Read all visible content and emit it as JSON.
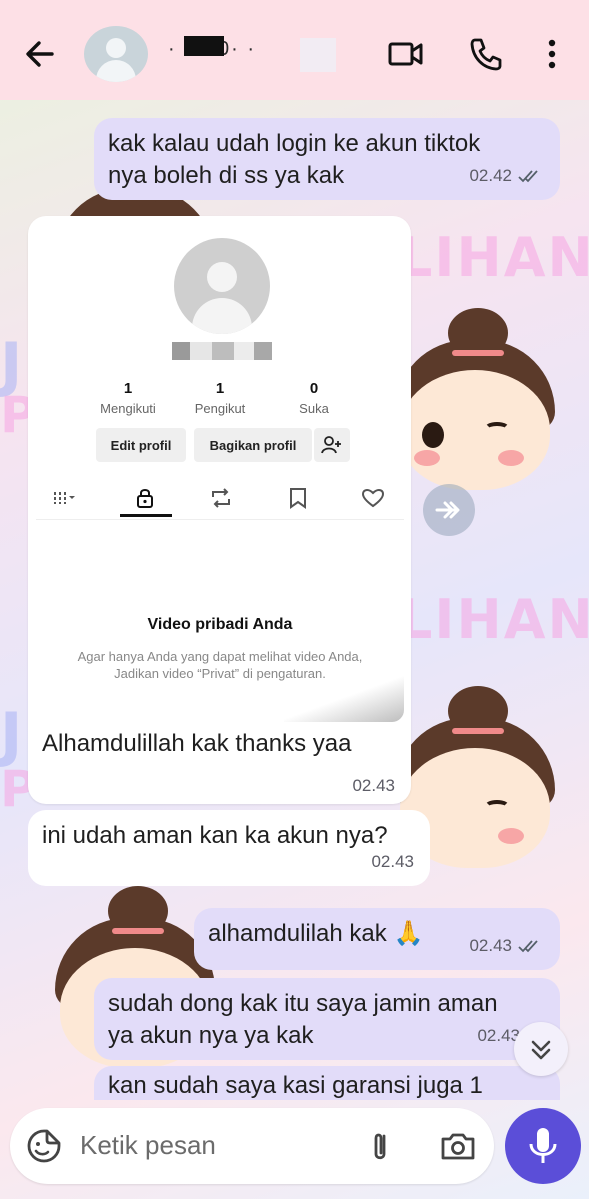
{
  "header": {
    "contact_name": "· 52 0·  ·",
    "icons": [
      "back-arrow-icon",
      "video-call-icon",
      "voice-call-icon",
      "more-vert-icon"
    ]
  },
  "wallpaper": {
    "words": [
      "LIHAN",
      "LIHAN"
    ],
    "colors": {
      "pink": "#f7a6e4",
      "blue": "#a9b3f5"
    }
  },
  "messages": [
    {
      "id": "m1",
      "dir": "out",
      "lines": [
        "kak kalau udah login ke akun tiktok",
        "nya boleh di ss ya kak"
      ],
      "time": "02.42",
      "read": true
    },
    {
      "id": "m2",
      "dir": "in",
      "type": "image_caption",
      "text": "Alhamdulillah kak thanks yaa",
      "time": "02.43"
    },
    {
      "id": "m3",
      "dir": "in",
      "text": "ini udah aman kan ka akun nya?",
      "time": "02.43"
    },
    {
      "id": "m4",
      "dir": "out",
      "text": "alhamdulilah kak 🙏",
      "time": "02.43",
      "read": true
    },
    {
      "id": "m5",
      "dir": "out",
      "lines": [
        "sudah dong kak itu saya jamin aman",
        "ya akun nya ya kak"
      ],
      "time": "02.43"
    },
    {
      "id": "m6",
      "dir": "out",
      "text": "kan sudah saya kasi garansi juga 1"
    }
  ],
  "tiktok_screenshot": {
    "username": "@kmm7647",
    "stats": [
      {
        "value": "1",
        "label": "Mengikuti"
      },
      {
        "value": "1",
        "label": "Pengikut"
      },
      {
        "value": "0",
        "label": "Suka"
      }
    ],
    "buttons": {
      "edit": "Edit profil",
      "share": "Bagikan profil"
    },
    "empty_title": "Video pribadi Anda",
    "empty_desc": "Agar hanya Anda yang dapat melihat video Anda, Jadikan video “Privat” di pengaturan."
  },
  "composer": {
    "placeholder": "Ketik pesan",
    "icons": [
      "emoji-sticker-icon",
      "attach-icon",
      "camera-icon",
      "mic-icon"
    ]
  },
  "colors": {
    "header_bg": "#fde0e6",
    "outgoing_bubble": "#e2dcf9",
    "incoming_bubble": "#ffffff",
    "mic_button": "#5b4ed8"
  }
}
